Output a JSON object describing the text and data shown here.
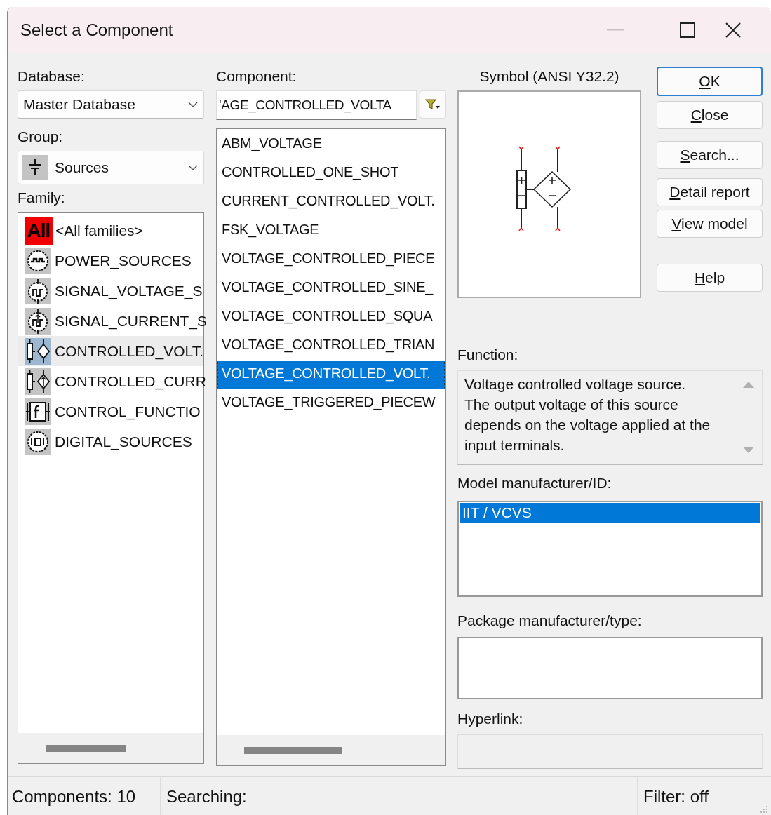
{
  "window": {
    "title": "Select a Component"
  },
  "database": {
    "label": "Database:",
    "value": "Master Database"
  },
  "group": {
    "label": "Group:",
    "value": "Sources"
  },
  "family": {
    "label": "Family:",
    "items": [
      {
        "kind": "all",
        "badge": "All",
        "label": "<All families>",
        "selected": false
      },
      {
        "kind": "power",
        "label": "POWER_SOURCES",
        "selected": false
      },
      {
        "kind": "signal_voltage",
        "label": "SIGNAL_VOLTAGE_S",
        "selected": false
      },
      {
        "kind": "signal_current",
        "label": "SIGNAL_CURRENT_S",
        "selected": false
      },
      {
        "kind": "controlled_voltage",
        "label": "CONTROLLED_VOLT.",
        "selected": true
      },
      {
        "kind": "controlled_current",
        "label": "CONTROLLED_CURR",
        "selected": false
      },
      {
        "kind": "control_function",
        "label": "CONTROL_FUNCTIO",
        "selected": false
      },
      {
        "kind": "digital",
        "label": "DIGITAL_SOURCES",
        "selected": false
      }
    ]
  },
  "component": {
    "label": "Component:",
    "value": "'AGE_CONTROLLED_VOLTA",
    "items": [
      {
        "label": "ABM_VOLTAGE",
        "selected": false
      },
      {
        "label": "CONTROLLED_ONE_SHOT",
        "selected": false
      },
      {
        "label": "CURRENT_CONTROLLED_VOLT.",
        "selected": false
      },
      {
        "label": "FSK_VOLTAGE",
        "selected": false
      },
      {
        "label": "VOLTAGE_CONTROLLED_PIECE",
        "selected": false
      },
      {
        "label": "VOLTAGE_CONTROLLED_SINE_",
        "selected": false
      },
      {
        "label": "VOLTAGE_CONTROLLED_SQUA",
        "selected": false
      },
      {
        "label": "VOLTAGE_CONTROLLED_TRIAN",
        "selected": false
      },
      {
        "label": "VOLTAGE_CONTROLLED_VOLT.",
        "selected": true
      },
      {
        "label": "VOLTAGE_TRIGGERED_PIECEW",
        "selected": false
      }
    ]
  },
  "symbol": {
    "label": "Symbol (ANSI Y32.2)"
  },
  "buttons": [
    {
      "label": "OK",
      "default": true
    },
    {
      "label": "Close",
      "default": false
    },
    {
      "label": "Search...",
      "default": false
    },
    {
      "label": "Detail report",
      "default": false
    },
    {
      "label": "View model",
      "default": false
    },
    {
      "label": "Help",
      "default": false
    }
  ],
  "function": {
    "label": "Function:",
    "text": "Voltage controlled voltage source. The output voltage of this source depends on the voltage applied at the input terminals."
  },
  "model": {
    "label": "Model manufacturer/ID:",
    "items": [
      {
        "label": "IIT / VCVS",
        "selected": true
      }
    ]
  },
  "package": {
    "label": "Package manufacturer/type:"
  },
  "hyperlink": {
    "label": "Hyperlink:"
  },
  "status_bar": [
    {
      "text": "Components: 10"
    },
    {
      "text": "Searching:"
    },
    {
      "text": "Filter: off"
    }
  ]
}
